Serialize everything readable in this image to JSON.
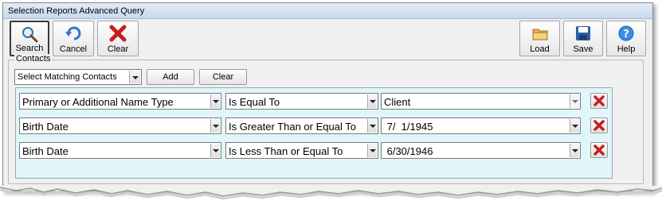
{
  "window": {
    "title": "Selection Reports Advanced Query"
  },
  "toolbar": {
    "search_label": "Search",
    "cancel_label": "Cancel",
    "clear_label": "Clear",
    "load_label": "Load",
    "save_label": "Save",
    "help_label": "Help"
  },
  "contacts": {
    "group_label": "Contacts",
    "match_select": "Select Matching Contacts",
    "add_label": "Add",
    "clear_label": "Clear"
  },
  "criteria": [
    {
      "field": "Primary or Additional Name Type",
      "operator": "Is Equal To",
      "value": "Client"
    },
    {
      "field": "Birth Date",
      "operator": "Is Greater Than or Equal To",
      "value": " 7/  1/1945"
    },
    {
      "field": "Birth Date",
      "operator": "Is Less Than or Equal To",
      "value": " 6/30/1946"
    }
  ],
  "colors": {
    "panel_bg": "#e1f6fa",
    "delete_red": "#c81e1e",
    "title_bar": "#d5e2f3"
  },
  "icons": {
    "search": "magnifier-icon",
    "cancel": "undo-arrow-icon",
    "clear": "red-x-icon",
    "load": "folder-icon",
    "save": "floppy-disk-icon",
    "help": "help-question-icon",
    "delete": "red-x-icon"
  }
}
